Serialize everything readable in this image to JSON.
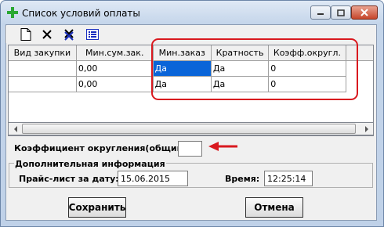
{
  "window": {
    "title": "Список условий оплаты"
  },
  "toolbar": {
    "buttons": [
      "new-icon",
      "delete-icon",
      "delete-all-icon",
      "list-icon"
    ]
  },
  "grid": {
    "columns": [
      "Вид закупки",
      "Мин.сум.зак.",
      "Мин.заказ",
      "Кратность",
      "Коэфф.округл."
    ],
    "rows": [
      [
        "",
        "0,00",
        "Да",
        "Да",
        "0"
      ],
      [
        "",
        "0,00",
        "Да",
        "Да",
        "0"
      ]
    ]
  },
  "rounding": {
    "label": "Коэффициент округления(общий):",
    "value": ""
  },
  "info": {
    "title": "Дополнительная информация",
    "price_label": "Прайс-лист за дату:",
    "price_date": "15.06.2015",
    "time_label": "Время:",
    "time_value": "12:25:14"
  },
  "buttons": {
    "save": "Сохранить",
    "cancel": "Отмена"
  },
  "colors": {
    "annotation": "#d9191f",
    "selection": "#0a64d8"
  }
}
